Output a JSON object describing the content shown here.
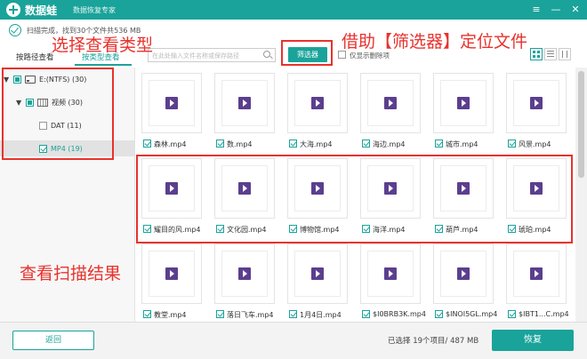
{
  "titlebar": {
    "app_name": "数据蛙",
    "subtitle": "数据恢复专家",
    "buttons": [
      "≡",
      "—",
      "✕"
    ]
  },
  "status": {
    "text": "扫描完成，找到30个文件共536 MB"
  },
  "tabs": [
    {
      "label": "按路径查看",
      "active": false
    },
    {
      "label": "按类型查看",
      "active": true
    }
  ],
  "tree": [
    {
      "label": "E:(NTFS) (30)",
      "level": 0
    },
    {
      "label": "视频 (30)",
      "level": 1
    },
    {
      "label": "DAT (11)",
      "level": 2
    },
    {
      "label": "MP4 (19)",
      "level": 2
    }
  ],
  "toolbar": {
    "search_placeholder": "在此处输入文件名称或保存路径",
    "filter_label": "筛选器",
    "deleted_only_label": "仅显示删除项"
  },
  "files": [
    [
      "森林.mp4",
      "数.mp4",
      "大海.mp4",
      "海边.mp4",
      "城市.mp4",
      "风景.mp4"
    ],
    [
      "耀目的风.mp4",
      "文化园.mp4",
      "博物馆.mp4",
      "海洋.mp4",
      "葫芦.mp4",
      "琥珀.mp4"
    ],
    [
      "教堂.mp4",
      "落日飞车.mp4",
      "1月4日.mp4",
      "$I0BRB3K.mp4",
      "$INOI5GL.mp4",
      "$IBT1...C.mp4"
    ]
  ],
  "bottom": {
    "back_label": "返回",
    "selection_info": "已选择 19个项目/ 487 MB",
    "recover_label": "恢复"
  },
  "annotations": {
    "filter": "借助【筛选器】定位文件",
    "type": "选择查看类型",
    "results": "查看扫描结果"
  },
  "colors": {
    "accent": "#1aa39a",
    "annotation": "#e8322d",
    "video_icon": "#5b3f8e"
  },
  "icons": {
    "logo": "plus-cross-icon",
    "video": "video-file-icon",
    "search": "search-icon"
  }
}
